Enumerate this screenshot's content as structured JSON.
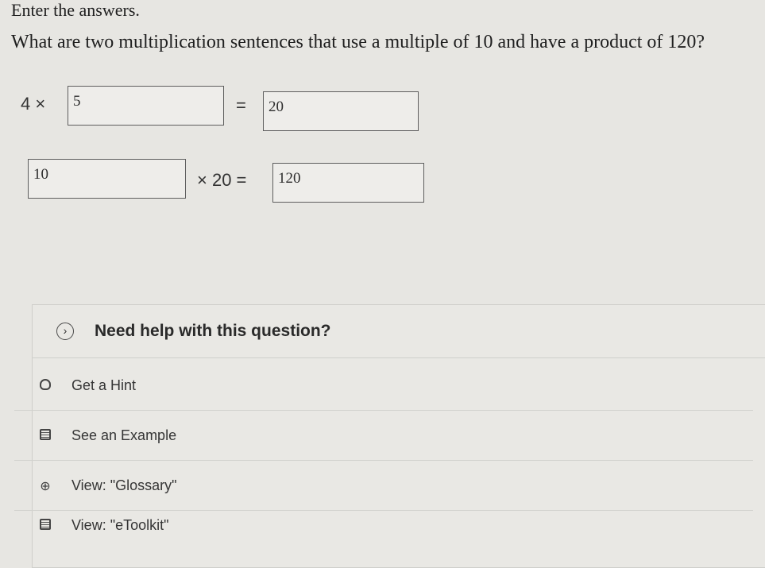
{
  "instructions": "Enter the answers.",
  "question": "What are two multiplication sentences that use a multiple of 10 and have a product of 120?",
  "equation1": {
    "left": "4 ×",
    "answer_factor": "5",
    "equals": "=",
    "answer_product": "20"
  },
  "equation2": {
    "answer_factor": "10",
    "middle": "× 20 =",
    "answer_product": "120"
  },
  "help": {
    "toggle_icon": "chevron-right-icon",
    "title": "Need help with this question?",
    "resources": [
      {
        "icon": "lightbulb-icon",
        "label": "Get a Hint"
      },
      {
        "icon": "example-doc-icon",
        "label": "See an Example"
      },
      {
        "icon": "glossary-icon",
        "label": "View: \"Glossary\""
      },
      {
        "icon": "etoolkit-icon",
        "label": "View: \"eToolkit\""
      }
    ]
  }
}
